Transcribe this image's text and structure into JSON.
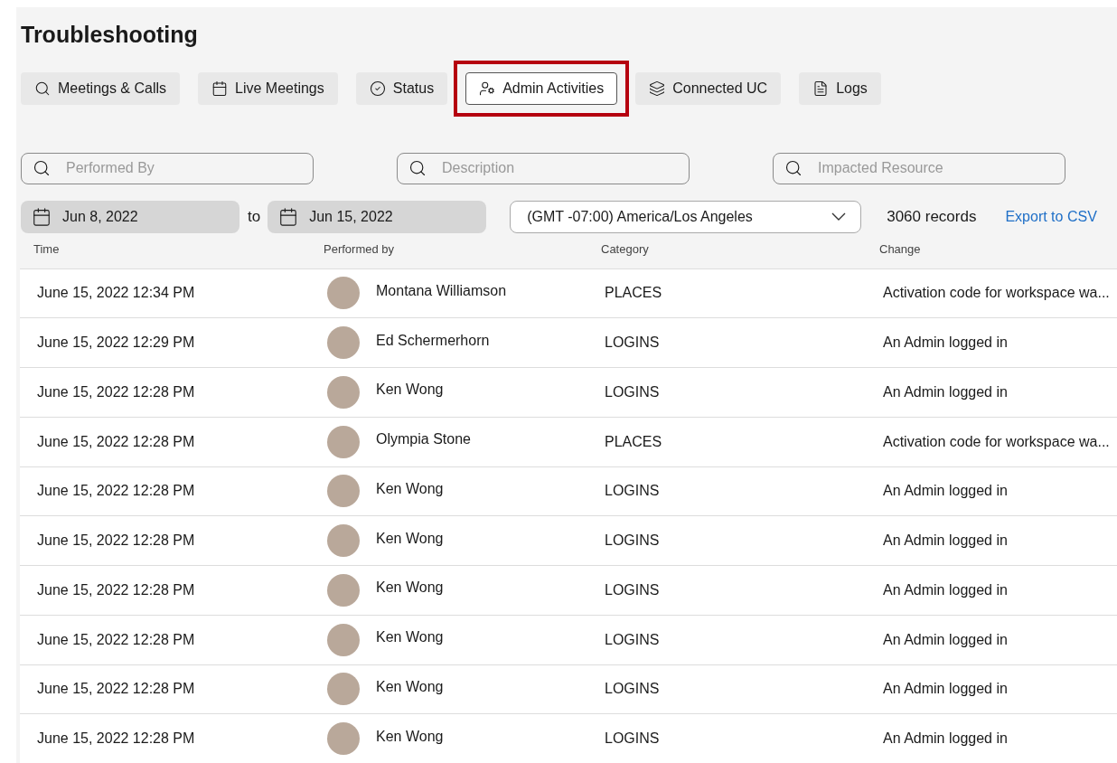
{
  "title": "Troubleshooting",
  "tabs": [
    {
      "label": "Meetings & Calls",
      "selected": false
    },
    {
      "label": "Live Meetings",
      "selected": false
    },
    {
      "label": "Status",
      "selected": false
    },
    {
      "label": "Admin Activities",
      "selected": true
    },
    {
      "label": "Connected UC",
      "selected": false
    },
    {
      "label": "Logs",
      "selected": false
    }
  ],
  "filters": [
    {
      "placeholder": "Performed By"
    },
    {
      "placeholder": "Description"
    },
    {
      "placeholder": "Impacted Resource"
    }
  ],
  "date_from": "Jun 8, 2022",
  "date_separator": "to",
  "date_to": "Jun 15, 2022",
  "timezone": "(GMT -07:00) America/Los Angeles",
  "records": "3060 records",
  "export_link": "Export to CSV",
  "table": {
    "columns": [
      "Time",
      "Performed by",
      "Category",
      "Change"
    ],
    "rows": [
      {
        "time": "June 15, 2022 12:34 PM",
        "performed_by": "Montana Williamson",
        "category": "PLACES",
        "change": "Activation code for workspace wa..."
      },
      {
        "time": "June 15, 2022 12:29 PM",
        "performed_by": "Ed Schermerhorn",
        "category": "LOGINS",
        "change": "An Admin logged in"
      },
      {
        "time": "June 15, 2022 12:28 PM",
        "performed_by": "Ken Wong",
        "category": "LOGINS",
        "change": "An Admin logged in"
      },
      {
        "time": "June 15, 2022 12:28 PM",
        "performed_by": "Olympia Stone",
        "category": "PLACES",
        "change": "Activation code for workspace wa..."
      },
      {
        "time": "June 15, 2022 12:28 PM",
        "performed_by": "Ken Wong",
        "category": "LOGINS",
        "change": "An Admin logged in"
      },
      {
        "time": "June 15, 2022 12:28 PM",
        "performed_by": "Ken Wong",
        "category": "LOGINS",
        "change": "An Admin logged in"
      },
      {
        "time": "June 15, 2022 12:28 PM",
        "performed_by": "Ken Wong",
        "category": "LOGINS",
        "change": "An Admin logged in"
      },
      {
        "time": "June 15, 2022 12:28 PM",
        "performed_by": "Ken Wong",
        "category": "LOGINS",
        "change": "An Admin logged in"
      },
      {
        "time": "June 15, 2022 12:28 PM",
        "performed_by": "Ken Wong",
        "category": "LOGINS",
        "change": "An Admin logged in"
      },
      {
        "time": "June 15, 2022 12:28 PM",
        "performed_by": "Ken Wong",
        "category": "LOGINS",
        "change": "An Admin logged in"
      }
    ]
  }
}
